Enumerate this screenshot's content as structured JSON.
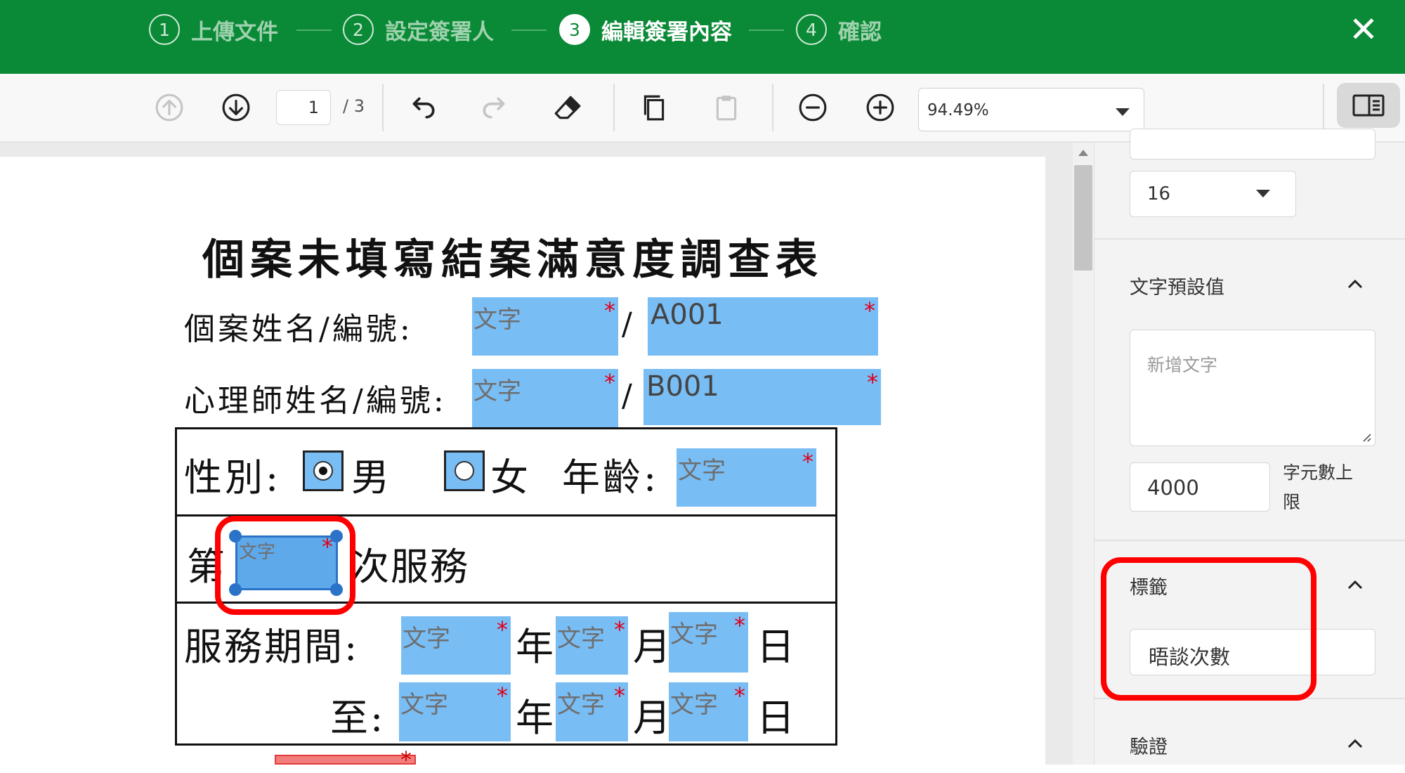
{
  "stepper": {
    "steps": [
      {
        "num": "1",
        "label": "上傳文件"
      },
      {
        "num": "2",
        "label": "設定簽署人"
      },
      {
        "num": "3",
        "label": "編輯簽署內容"
      },
      {
        "num": "4",
        "label": "確認"
      }
    ],
    "active_step": 3,
    "close_label": "✕"
  },
  "toolbar": {
    "current_page": "1",
    "page_total": "/ 3",
    "zoom": "94.49%"
  },
  "document": {
    "title": "個案未填寫結案滿意度調查表",
    "row_client": "個案姓名/編號:",
    "row_psych": "心理師姓名/編號:",
    "slash": "/",
    "gender_label": "性別:",
    "male": "男",
    "female": "女",
    "age_label": "年齡:",
    "session_prefix": "第",
    "session_suffix": "次服務",
    "period_label": "服務期間:",
    "to_label": "至:",
    "year": "年",
    "month": "月",
    "day": "日",
    "field_placeholder": "文字",
    "required_mark": "*",
    "client_id_value": "A001",
    "psych_id_value": "B001"
  },
  "right_panel": {
    "font_size": "16",
    "default_text_heading": "文字預設值",
    "default_text_placeholder": "新增文字",
    "char_limit_value": "4000",
    "char_limit_label_line1": "字元數上",
    "char_limit_label_line2": "限",
    "label_heading": "標籤",
    "label_value": "晤談次數",
    "validation_heading": "驗證"
  },
  "colors": {
    "brand_green": "#0a8a36",
    "field_blue": "#79bdf5",
    "required_red": "#e0001b",
    "highlight_red": "#ff0000"
  }
}
